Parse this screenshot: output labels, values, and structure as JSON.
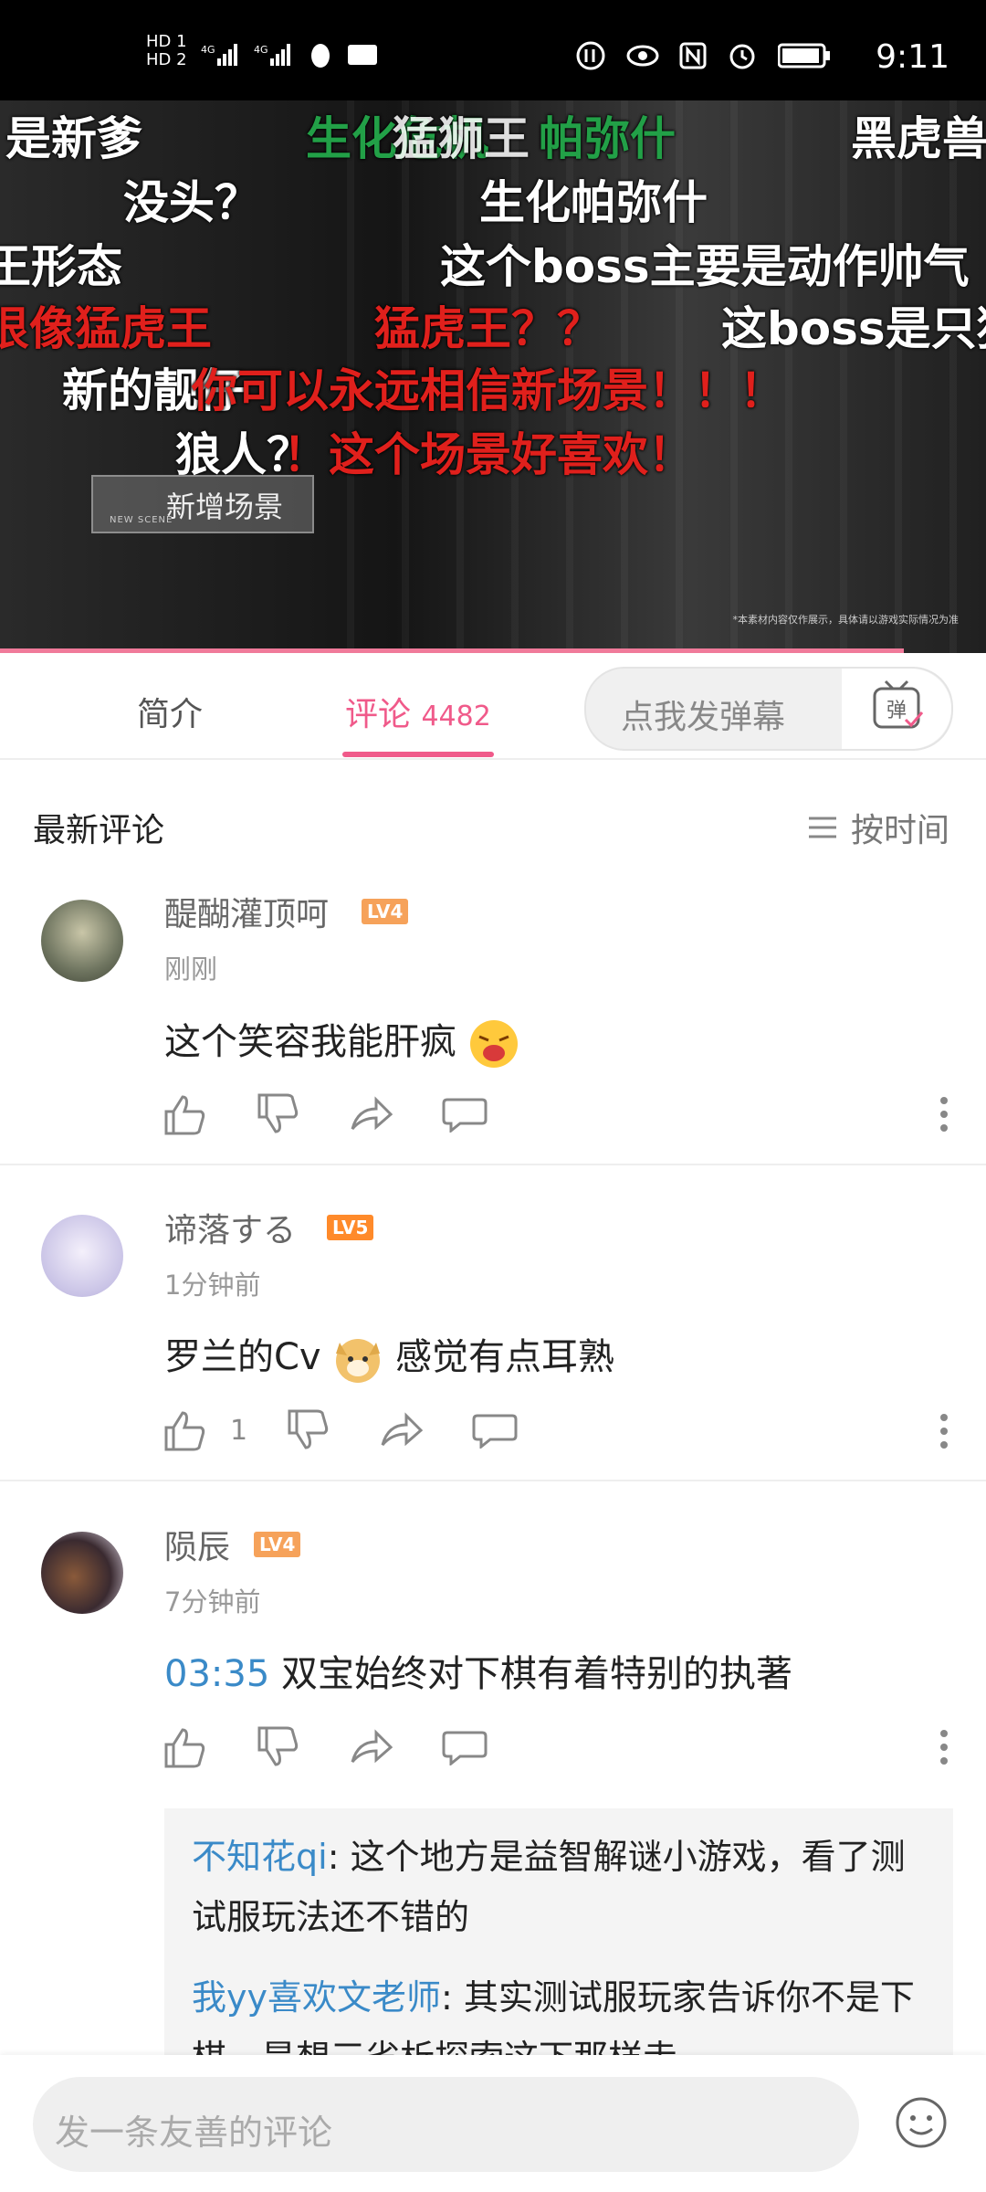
{
  "status_bar": {
    "time": "9:11",
    "left_labels": [
      "HD 1",
      "HD 2"
    ]
  },
  "video": {
    "danmaku": [
      {
        "text": "是新爹",
        "color": "white"
      },
      {
        "text": "生化危机",
        "color": "green"
      },
      {
        "text": "猛狮王",
        "color": "white"
      },
      {
        "text": "帕弥什",
        "color": "green"
      },
      {
        "text": "黑虎兽",
        "color": "white"
      },
      {
        "text": "没头？",
        "color": "white"
      },
      {
        "text": "生化帕弥什",
        "color": "white"
      },
      {
        "text": "王形态",
        "color": "white"
      },
      {
        "text": "这个boss主要是动作帅气",
        "color": "white"
      },
      {
        "text": "很像猛虎王",
        "color": "red"
      },
      {
        "text": "猛虎王？？",
        "color": "red"
      },
      {
        "text": "这boss是只狼",
        "color": "white"
      },
      {
        "text": "新的靓仔",
        "color": "white"
      },
      {
        "text": "你可以永远相信新场景！！！",
        "color": "red"
      },
      {
        "text": "狼人？",
        "color": "white"
      },
      {
        "text": "！这个场景好喜欢！",
        "color": "red"
      }
    ],
    "scene_tag": "新增场景",
    "scene_tag_en": "NEW SCENE",
    "disclaimer": "*本素材内容仅作展示，具体请以游戏实际情况为准",
    "progress": 0.917
  },
  "tabs": {
    "intro": "简介",
    "comments": "评论",
    "comments_count": "4482",
    "danmu_placeholder": "点我发弹幕",
    "danmu_icon_label": "弹"
  },
  "comments_section": {
    "title": "最新评论",
    "sort_label": "按时间"
  },
  "comments": [
    {
      "user": "醍醐灌顶呵",
      "level": "LV4",
      "level_color": "#f6a25a",
      "time": "刚刚",
      "text": "这个笑容我能肝疯",
      "likes": ""
    },
    {
      "user": "谛落する",
      "level": "LV5",
      "level_color": "#ff8a2a",
      "time": "1分钟前",
      "text_before": "罗兰的Cv",
      "text_after": "感觉有点耳熟",
      "likes": "1"
    },
    {
      "user": "陨辰",
      "level": "LV4",
      "level_color": "#f6a25a",
      "time": "7分钟前",
      "timestamp_link": "03:35",
      "text": "双宝始终对下棋有着特别的执著",
      "likes": "",
      "replies": [
        {
          "user": "不知花qi",
          "text": ": 这个地方是益智解谜小游戏，看了测试服玩法还不错的"
        },
        {
          "user": "我yy喜欢文老师",
          "text": ": 其实测试服玩家告诉你不是下棋，是想三省析探索这下那样走"
        }
      ]
    }
  ],
  "bottom": {
    "input_placeholder": "发一条友善的评论"
  },
  "colors": {
    "accent": "#f05a8a",
    "link": "#3a8ac8"
  }
}
